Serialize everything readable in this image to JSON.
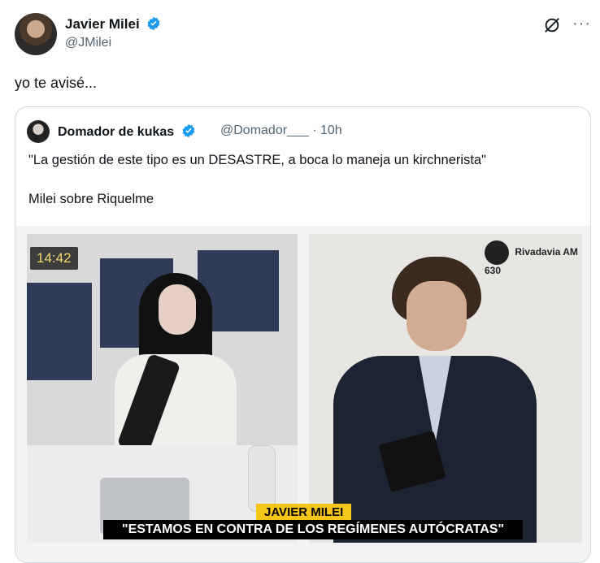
{
  "tweet": {
    "author_name": "Javier Milei",
    "handle": "@JMilei",
    "text": "yo te avisé...",
    "more_glyph": "···"
  },
  "quote": {
    "author_name": "Domador de kukas",
    "handle": "@Domador___ · 10h",
    "text_line1": "\"La gestión de este tipo es un DESASTRE, a boca lo maneja un kirchnerista\"",
    "text_line2": "Milei sobre Riquelme",
    "video": {
      "timestamp": "14:42",
      "station_logo": "Rivadavia AM 630",
      "lower_third_name": "JAVIER MILEI",
      "lower_third_quote": "\"ESTAMOS EN CONTRA DE LOS REGÍMENES AUTÓCRATAS\""
    }
  },
  "colors": {
    "verified": "#1d9bf0",
    "lower_third_yellow": "#f5c518"
  }
}
